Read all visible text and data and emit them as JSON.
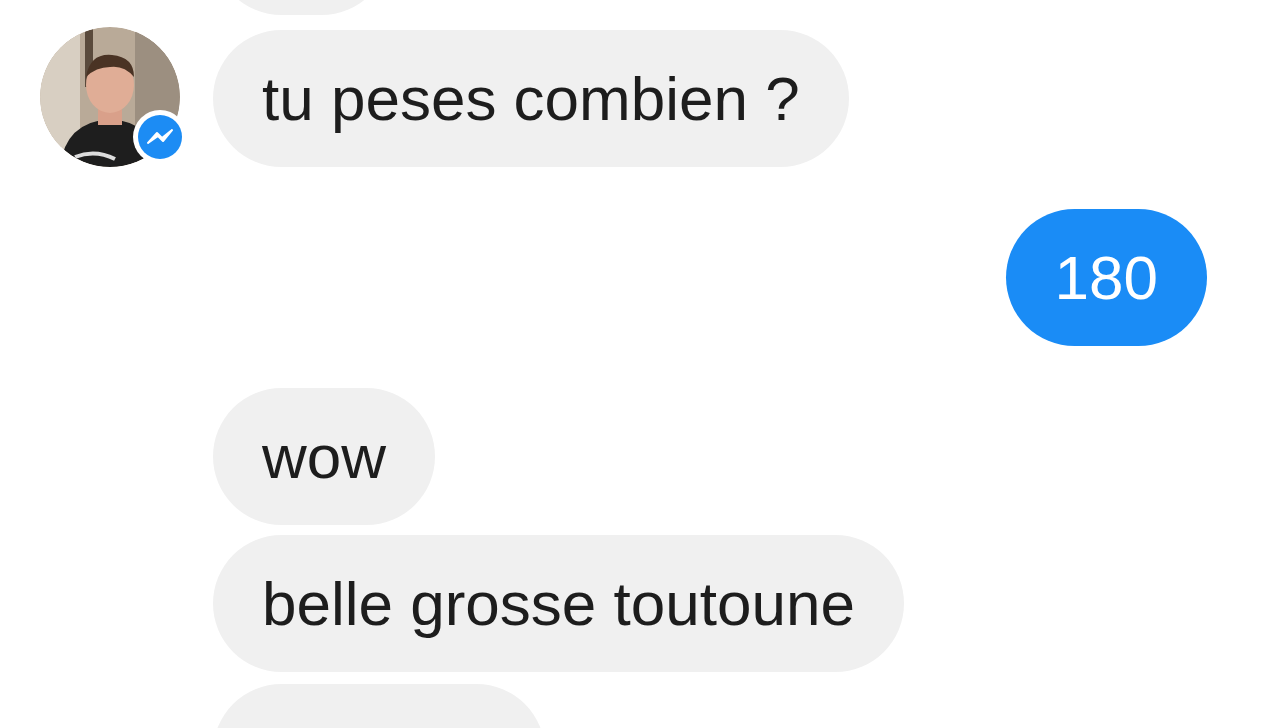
{
  "messages": [
    {
      "sent": false,
      "kind": "clipped",
      "avatar": false
    },
    {
      "sent": false,
      "kind": "text",
      "text": "tu peses combien ?",
      "avatar": true
    },
    {
      "sent": true,
      "kind": "text",
      "text": "180",
      "avatar": false
    },
    {
      "sent": false,
      "kind": "text",
      "text": "wow",
      "avatar": false
    },
    {
      "sent": false,
      "kind": "text",
      "text": "belle grosse toutoune",
      "avatar": false
    },
    {
      "sent": false,
      "kind": "clipped",
      "avatar": false
    }
  ]
}
